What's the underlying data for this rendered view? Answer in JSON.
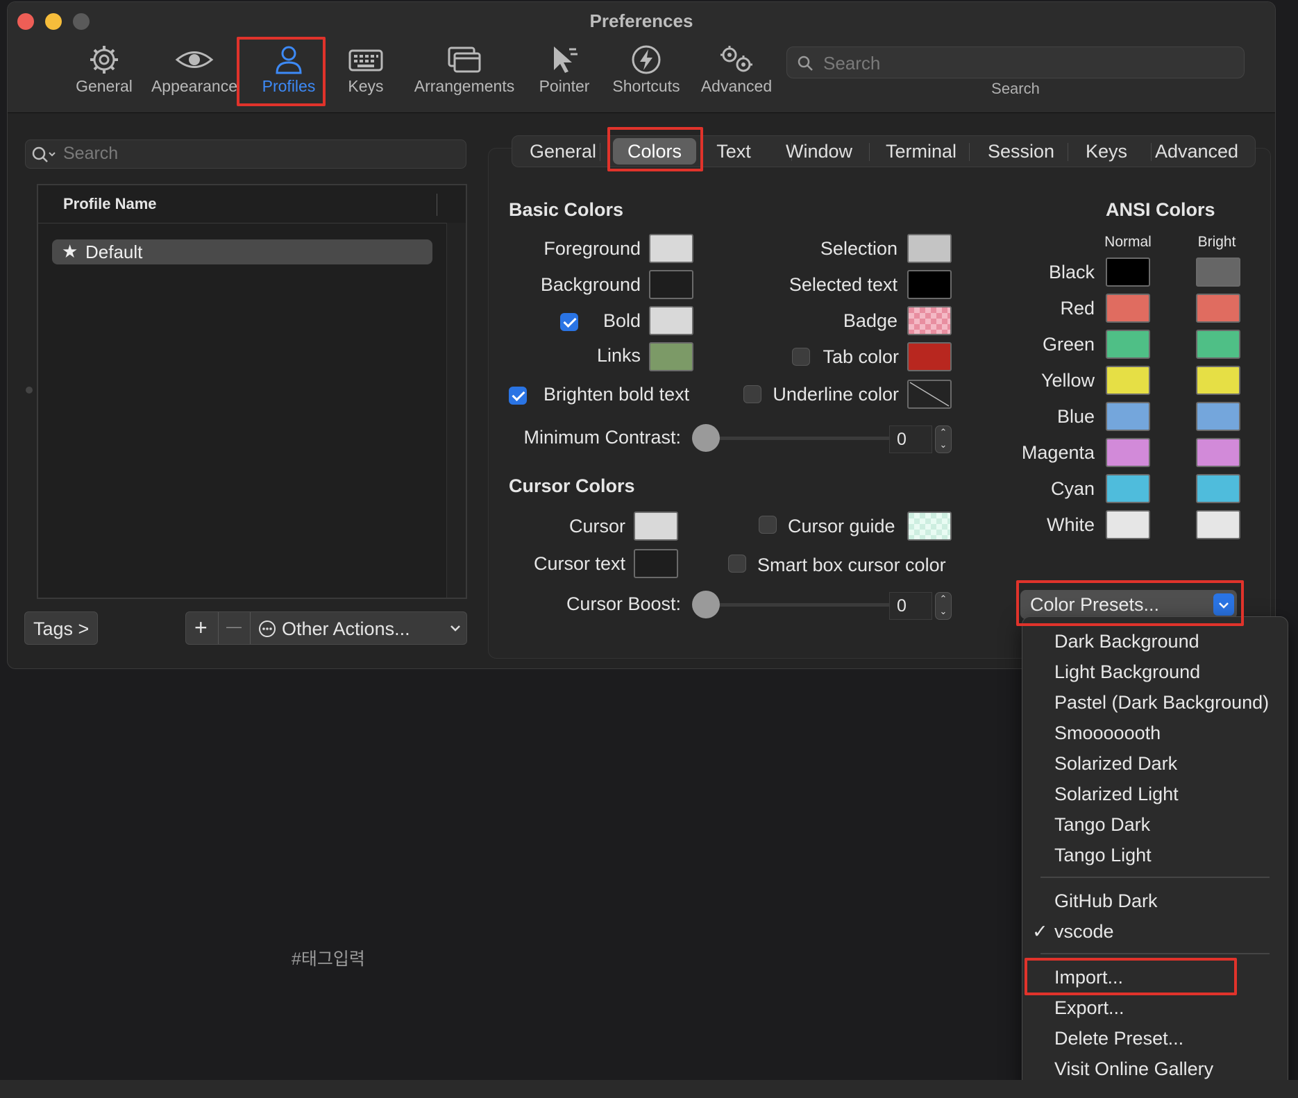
{
  "window": {
    "title": "Preferences"
  },
  "toolbar": {
    "items": [
      {
        "label": "General",
        "icon": "gear-icon"
      },
      {
        "label": "Appearance",
        "icon": "eye-icon"
      },
      {
        "label": "Profiles",
        "icon": "person-icon"
      },
      {
        "label": "Keys",
        "icon": "keyboard-icon"
      },
      {
        "label": "Arrangements",
        "icon": "windows-icon"
      },
      {
        "label": "Pointer",
        "icon": "pointer-icon"
      },
      {
        "label": "Shortcuts",
        "icon": "bolt-icon"
      },
      {
        "label": "Advanced",
        "icon": "gears-icon"
      }
    ],
    "search_placeholder": "Search",
    "search_label": "Search",
    "selected": "Profiles",
    "accent": "#2a74e4"
  },
  "sidebar": {
    "search_placeholder": "Search",
    "column_header": "Profile Name",
    "profiles": [
      {
        "name": "Default",
        "star": "★"
      }
    ],
    "tags_button": "Tags >",
    "add_symbol": "+",
    "remove_symbol": "—",
    "other_actions": "Other Actions..."
  },
  "tabs": {
    "items": [
      "General",
      "Colors",
      "Text",
      "Window",
      "Terminal",
      "Session",
      "Keys",
      "Advanced"
    ],
    "selected": "Colors"
  },
  "basic_colors": {
    "heading": "Basic Colors",
    "foreground": {
      "label": "Foreground",
      "color": "#d9d9d9"
    },
    "background": {
      "label": "Background",
      "color": "#1e1e1e"
    },
    "bold": {
      "label": "Bold",
      "checked": true,
      "color": "#d9d9d9"
    },
    "links": {
      "label": "Links",
      "color": "#7c9a67"
    },
    "brighten_bold": {
      "label": "Brighten bold text",
      "checked": true
    },
    "selection": {
      "label": "Selection",
      "color": "#c4c4c4"
    },
    "selected_text": {
      "label": "Selected text",
      "color": "#000000"
    },
    "badge": {
      "label": "Badge",
      "color": "#e88ea0"
    },
    "tab_color": {
      "label": "Tab color",
      "checked": false,
      "color": "#b8271f"
    },
    "underline_color": {
      "label": "Underline color",
      "checked": false
    },
    "min_contrast": {
      "label": "Minimum Contrast:",
      "value": "0"
    }
  },
  "cursor_colors": {
    "heading": "Cursor Colors",
    "cursor": {
      "label": "Cursor",
      "color": "#d9d9d9"
    },
    "cursor_text": {
      "label": "Cursor text",
      "color": "#1e1e1e"
    },
    "cursor_guide": {
      "label": "Cursor guide",
      "checked": false,
      "color": "#cdeee0"
    },
    "smart_box": {
      "label": "Smart box cursor color",
      "checked": false
    },
    "cursor_boost": {
      "label": "Cursor Boost:",
      "value": "0"
    }
  },
  "ansi_colors": {
    "heading": "ANSI Colors",
    "normal_label": "Normal",
    "bright_label": "Bright",
    "rows": [
      {
        "name": "Black",
        "normal": "#000000",
        "bright": "#666666"
      },
      {
        "name": "Red",
        "normal": "#e06c60",
        "bright": "#e06c60"
      },
      {
        "name": "Green",
        "normal": "#4fbf86",
        "bright": "#4fbf86"
      },
      {
        "name": "Yellow",
        "normal": "#e6df45",
        "bright": "#e6df45"
      },
      {
        "name": "Blue",
        "normal": "#74a6dc",
        "bright": "#74a6dc"
      },
      {
        "name": "Magenta",
        "normal": "#d28ad9",
        "bright": "#d28ad9"
      },
      {
        "name": "Cyan",
        "normal": "#4fbcdc",
        "bright": "#4fbcdc"
      },
      {
        "name": "White",
        "normal": "#e6e6e6",
        "bright": "#e6e6e6"
      }
    ]
  },
  "presets": {
    "button_label": "Color Presets...",
    "menu": {
      "builtin": [
        "Dark Background",
        "Light Background",
        "Pastel (Dark Background)",
        "Smooooooth",
        "Solarized Dark",
        "Solarized Light",
        "Tango Dark",
        "Tango Light"
      ],
      "custom": [
        "GitHub Dark",
        "vscode"
      ],
      "checked": "vscode",
      "check_symbol": "✓",
      "actions": [
        "Import...",
        "Export...",
        "Delete Preset...",
        "Visit Online Gallery"
      ]
    }
  },
  "footer_tag": "#태그입력",
  "highlight_color": "#e0332b"
}
